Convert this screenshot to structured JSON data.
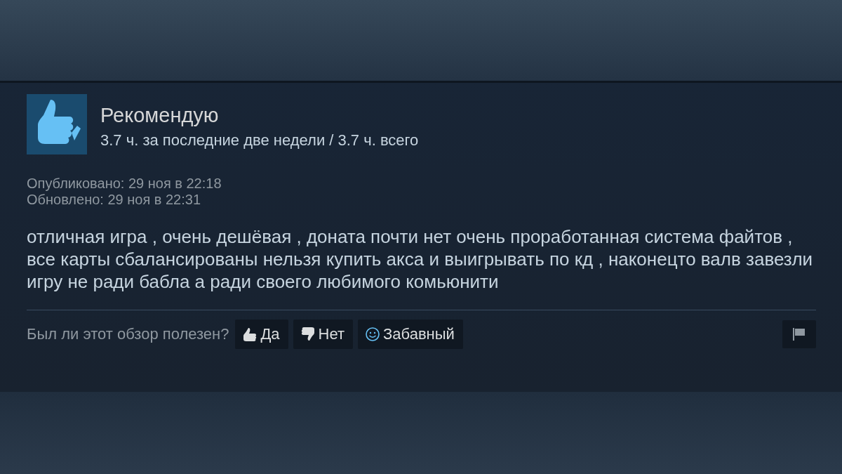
{
  "review": {
    "verdict": "Рекомендую",
    "hours": "3.7 ч. за последние две недели / 3.7 ч. всего",
    "posted": "Опубликовано: 29 ноя в 22:18",
    "updated": "Обновлено: 29 ноя в 22:31",
    "text": "отличная игра , очень дешёвая , доната почти нет очень проработанная система файтов , все карты сбалансированы нельзя купить акса и выигрывать по кд , наконецто валв завезли игру не ради бабла а ради своего любимого комьюнити"
  },
  "footer": {
    "question": "Был ли этот обзор полезен?",
    "buttons": [
      {
        "kind": "up",
        "label": "Да"
      },
      {
        "kind": "down",
        "label": "Нет"
      },
      {
        "kind": "funny",
        "label": "Забавный"
      }
    ]
  }
}
